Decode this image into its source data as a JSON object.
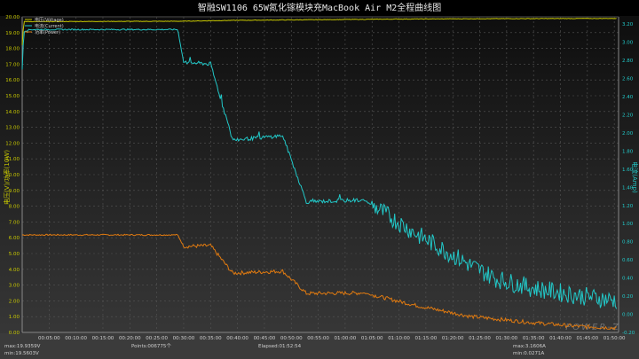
{
  "chart_data": {
    "type": "line",
    "title": "智融SW1106 65W氮化镓模块充MacBook Air M2全程曲线图",
    "xlabel": "",
    "ylabel_left": "电压(V)/功率(10W)",
    "ylabel_right": "电流(Amp)",
    "xlim_minutes": [
      0,
      110.8
    ],
    "ylim_left": [
      0,
      20
    ],
    "ylim_right": [
      -0.2,
      3.28
    ],
    "grid": true,
    "legend_position": "top-left",
    "x_tick_labels": [
      "00:05:00",
      "00:10:00",
      "00:15:00",
      "00:20:00",
      "00:25:00",
      "00:30:00",
      "00:35:00",
      "00:40:00",
      "00:45:00",
      "00:50:00",
      "00:55:00",
      "01:00:00",
      "01:05:00",
      "01:10:00",
      "01:15:00",
      "01:20:00",
      "01:25:00",
      "01:30:00",
      "01:35:00",
      "01:40:00",
      "01:45:00",
      "01:50:00"
    ],
    "left_tick_labels": [
      "0.00",
      "1.00",
      "2.00",
      "3.00",
      "4.00",
      "5.00",
      "6.00",
      "7.00",
      "8.00",
      "9.00",
      "10.00",
      "11.00",
      "12.00",
      "13.00",
      "14.00",
      "15.00",
      "16.00",
      "17.00",
      "18.00",
      "19.00",
      "20.00"
    ],
    "right_tick_labels": [
      "-0.20",
      "0.00",
      "0.20",
      "0.40",
      "0.60",
      "0.80",
      "1.00",
      "1.20",
      "1.40",
      "1.60",
      "1.80",
      "2.00",
      "2.20",
      "2.40",
      "2.60",
      "2.80",
      "3.00",
      "3.20"
    ],
    "series": [
      {
        "name": "电压(Voltage)",
        "axis": "left",
        "unit": "V",
        "color": "#c8c800",
        "x_minutes": [
          0,
          0.3,
          28.9,
          40,
          55,
          70,
          85,
          110.5
        ],
        "values": [
          18.2,
          19.7,
          19.72,
          19.78,
          19.82,
          19.86,
          19.88,
          19.9
        ]
      },
      {
        "name": "电流(Current)",
        "axis": "right",
        "unit": "A",
        "color": "#22c8c8",
        "x_minutes": [
          0,
          0.3,
          1.5,
          28.9,
          30.0,
          35.0,
          39.1,
          48.4,
          52.8,
          63.5,
          73.4,
          83.3,
          88.2,
          94.8,
          103.1,
          110.5
        ],
        "values": [
          2.7,
          3.12,
          3.14,
          3.14,
          2.78,
          2.76,
          1.92,
          1.97,
          1.24,
          1.26,
          0.88,
          0.54,
          0.39,
          0.29,
          0.21,
          0.15
        ]
      },
      {
        "name": "功率(Power)",
        "axis": "left",
        "unit": "10W",
        "color": "#e07a10",
        "x_minutes": [
          0,
          28.9,
          30.0,
          35.0,
          39.1,
          48.4,
          52.8,
          63.5,
          73.4,
          83.3,
          94.8,
          103.1,
          110.5
        ],
        "values": [
          6.18,
          6.18,
          5.45,
          5.5,
          3.76,
          3.88,
          2.47,
          2.5,
          1.69,
          1.01,
          0.62,
          0.39,
          0.28
        ]
      }
    ]
  },
  "footer": {
    "voltage_max": "max:19.9359V",
    "voltage_min": "min:19.5603V",
    "points": "Points:006775个",
    "elapsed": "Elapsed:01:52:54",
    "current_max": "max:3.1606A",
    "current_min": "min:0.0271A"
  },
  "watermark": "POWER-Z",
  "colors": {
    "voltage": "#c8c800",
    "current": "#22c8c8",
    "power": "#e07a10",
    "left_axis": "#c8c800",
    "right_axis": "#22c8c8"
  }
}
